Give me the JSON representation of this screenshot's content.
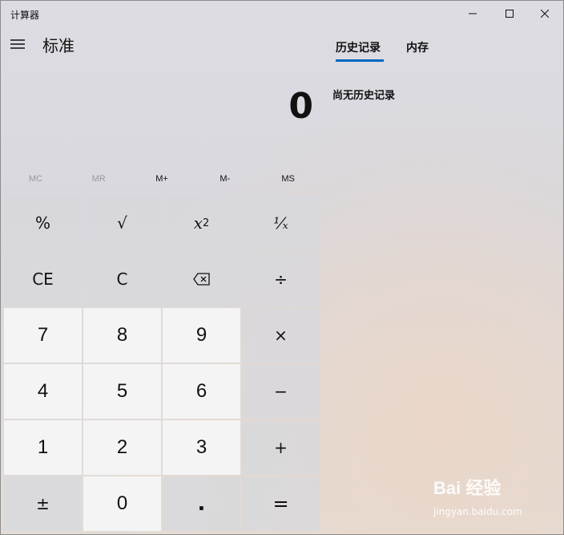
{
  "window": {
    "title": "计算器"
  },
  "header": {
    "mode": "标准"
  },
  "display": {
    "value": "0"
  },
  "memory": {
    "mc": "MC",
    "mr": "MR",
    "mplus": "M+",
    "mminus": "M-",
    "ms": "MS"
  },
  "keys": {
    "percent": "%",
    "sqrt": "√",
    "square_base": "x",
    "square_exp": "2",
    "recip": "¹⁄ₓ",
    "ce": "CE",
    "c": "C",
    "divide": "÷",
    "seven": "7",
    "eight": "8",
    "nine": "9",
    "multiply": "×",
    "four": "4",
    "five": "5",
    "six": "6",
    "minus": "−",
    "one": "1",
    "two": "2",
    "three": "3",
    "plus": "+",
    "negate": "±",
    "zero": "0",
    "decimal": ".",
    "equals": "="
  },
  "side": {
    "tabs": [
      {
        "label": "历史记录"
      },
      {
        "label": "内存"
      }
    ],
    "history_empty": "尚无历史记录"
  },
  "watermark": {
    "brand": "Bai 经验",
    "url": "jingyan.baidu.com"
  },
  "colors": {
    "accent": "#0067c0",
    "numkey": "#f4f4f4"
  }
}
